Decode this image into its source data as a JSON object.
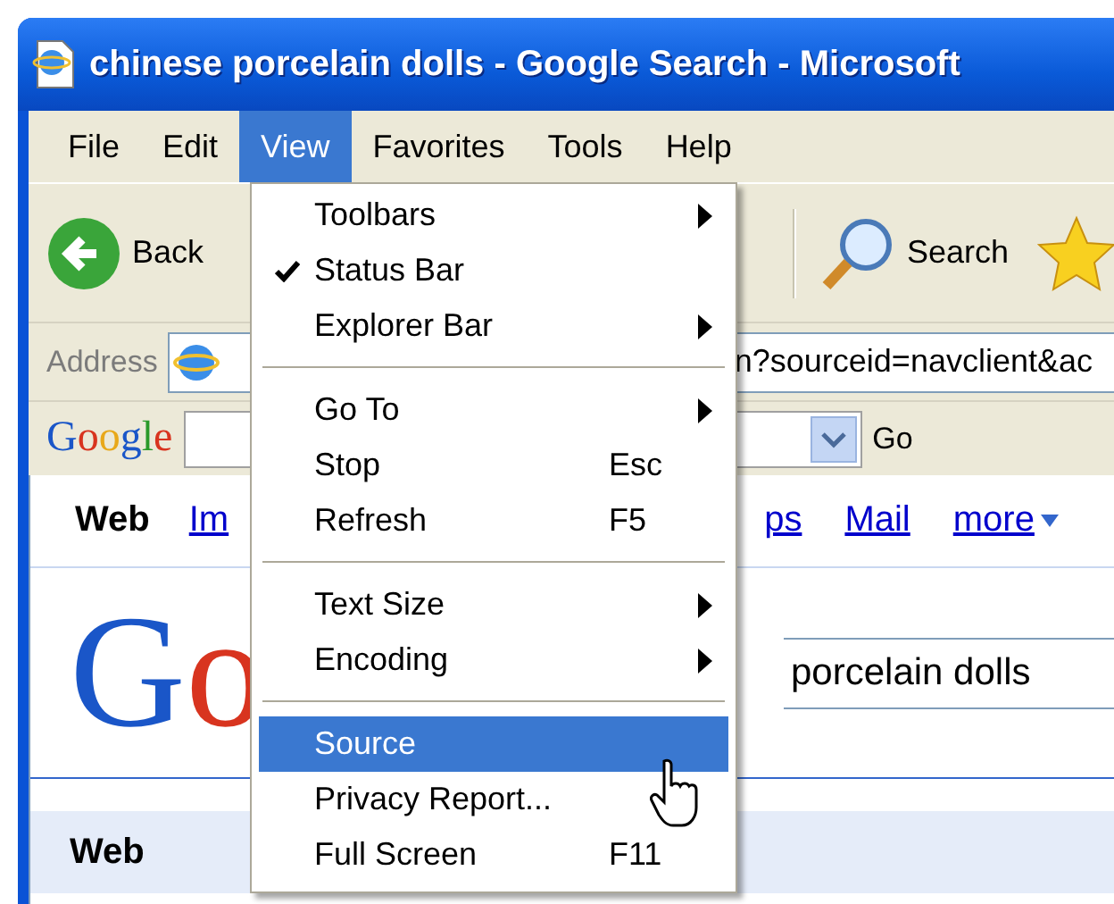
{
  "window": {
    "title": "chinese porcelain dolls - Google Search - Microsoft"
  },
  "menu_bar": [
    {
      "label": "File",
      "selected": false
    },
    {
      "label": "Edit",
      "selected": false
    },
    {
      "label": "View",
      "selected": true
    },
    {
      "label": "Favorites",
      "selected": false
    },
    {
      "label": "Tools",
      "selected": false
    },
    {
      "label": "Help",
      "selected": false
    }
  ],
  "toolbar": {
    "back": "Back",
    "search": "Search"
  },
  "address_bar": {
    "label": "Address",
    "value": "n?sourceid=navclient&ac"
  },
  "google_toolbar": {
    "logo": "Google",
    "go": "Go"
  },
  "nav_links": [
    {
      "label": "Web",
      "selected": true
    },
    {
      "label": "Im",
      "selected": false
    },
    {
      "label": "ps",
      "selected": false
    },
    {
      "label": "Mail",
      "selected": false
    },
    {
      "label": "more",
      "selected": false
    }
  ],
  "logo": "Go",
  "search": {
    "value": "porcelain dolls"
  },
  "results_bar": {
    "label": "Web"
  },
  "view_menu": [
    {
      "kind": "item",
      "label": "Toolbars",
      "submenu": true,
      "checked": false,
      "selected": false
    },
    {
      "kind": "item",
      "label": "Status Bar",
      "submenu": false,
      "checked": true,
      "selected": false
    },
    {
      "kind": "item",
      "label": "Explorer Bar",
      "submenu": true,
      "checked": false,
      "selected": false
    },
    {
      "kind": "separator"
    },
    {
      "kind": "item",
      "label": "Go To",
      "submenu": true,
      "checked": false,
      "selected": false
    },
    {
      "kind": "item",
      "label": "Stop",
      "shortcut": "Esc",
      "submenu": false,
      "checked": false,
      "selected": false
    },
    {
      "kind": "item",
      "label": "Refresh",
      "shortcut": "F5",
      "submenu": false,
      "checked": false,
      "selected": false
    },
    {
      "kind": "separator"
    },
    {
      "kind": "item",
      "label": "Text Size",
      "submenu": true,
      "checked": false,
      "selected": false
    },
    {
      "kind": "item",
      "label": "Encoding",
      "submenu": true,
      "checked": false,
      "selected": false
    },
    {
      "kind": "separator"
    },
    {
      "kind": "item",
      "label": "Source",
      "submenu": false,
      "checked": false,
      "selected": true
    },
    {
      "kind": "item",
      "label": "Privacy Report...",
      "submenu": false,
      "checked": false,
      "selected": false
    },
    {
      "kind": "item",
      "label": "Full Screen",
      "shortcut": "F11",
      "submenu": false,
      "checked": false,
      "selected": false
    }
  ]
}
